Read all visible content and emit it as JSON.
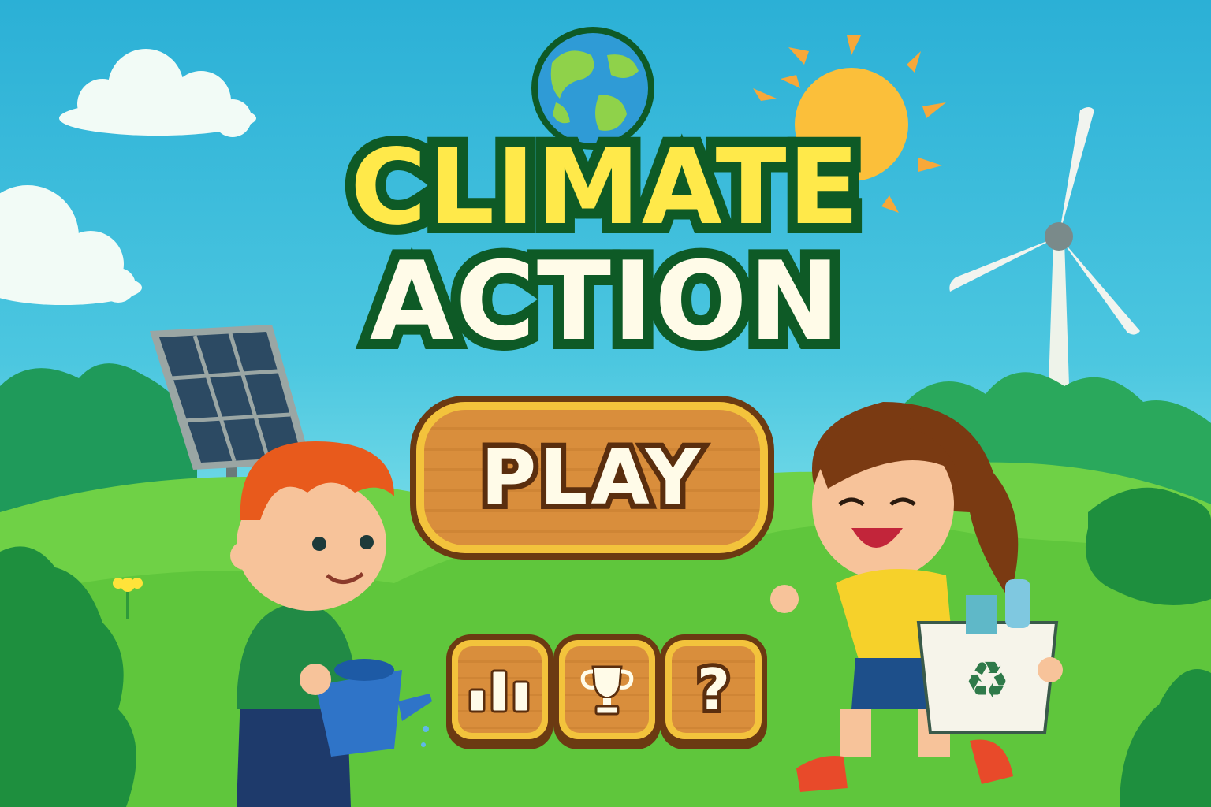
{
  "title": {
    "line1": "CLIMATE",
    "line2": "ACTION"
  },
  "play_button": {
    "label": "PLAY"
  },
  "menu_buttons": [
    {
      "name": "stats",
      "icon": "bar-chart-icon"
    },
    {
      "name": "trophy",
      "icon": "trophy-icon"
    },
    {
      "name": "help",
      "icon": "question-icon"
    }
  ],
  "help_glyph": "?",
  "bin_glyph": "♻",
  "colors": {
    "title_yellow": "#ffe94a",
    "title_cream": "#fffbe8",
    "title_outline": "#0e5a26",
    "wood": "#d98e3c",
    "wood_border": "#6b3a12",
    "grass": "#5fcf3e"
  }
}
